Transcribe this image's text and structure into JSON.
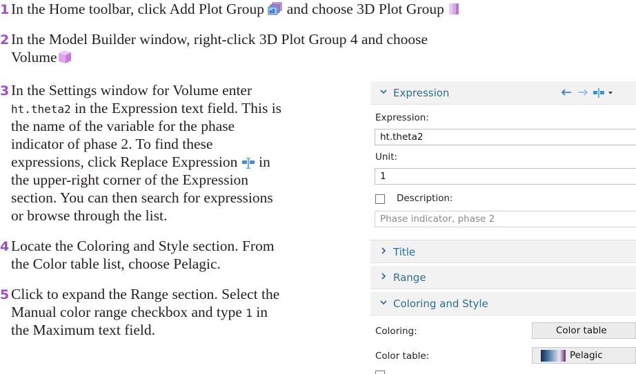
{
  "steps": [
    {
      "num": "1",
      "lines": [
        {
          "pre": "In the Home toolbar, click Add Plot Group",
          "mid": "and choose 3D Plot Group",
          "icon1": "plot-group-icon",
          "icon2": "3d-plot-group-icon"
        }
      ]
    },
    {
      "num": "2",
      "lines": [
        {
          "text": "In the Model Builder window, right-click 3D Plot Group 4 and choose"
        },
        {
          "text": "Volume",
          "icon": "volume-icon"
        }
      ]
    },
    {
      "num": "3",
      "lines": [
        {
          "text": "In the Settings window for Volume enter"
        },
        {
          "code": "ht.theta2",
          "text": " in the Expression text field. This is"
        },
        {
          "text": "the name of the variable for the phase"
        },
        {
          "text": "indicator of phase 2. To find these"
        },
        {
          "pre": "expressions, click Replace Expression",
          "post": "in",
          "icon": "replace-expression-icon"
        },
        {
          "text": "the upper-right corner of the Expression"
        },
        {
          "text": "section. You can then search for expressions"
        },
        {
          "text": "or browse through the list."
        }
      ]
    },
    {
      "num": "4",
      "lines": [
        {
          "text": "Locate the Coloring and Style section. From"
        },
        {
          "text": "the Color table list, choose Pelagic."
        }
      ]
    },
    {
      "num": "5",
      "lines": [
        {
          "text": "Click to expand the Range section. Select the"
        },
        {
          "pre": "Manual color range checkbox and type ",
          "code": "1",
          "post": " in"
        },
        {
          "text": "the Maximum text field."
        }
      ]
    }
  ],
  "panel": {
    "expression_section": {
      "title": "Expression",
      "expression_label": "Expression:",
      "expression_value": "ht.theta2",
      "unit_label": "Unit:",
      "unit_value": "1",
      "description_label": "Description:",
      "description_value": "Phase indicator, phase 2"
    },
    "title_section": {
      "title": "Title"
    },
    "range_section": {
      "title": "Range"
    },
    "coloring_section": {
      "title": "Coloring and Style",
      "coloring_label": "Coloring:",
      "coloring_value": "Color table",
      "color_table_label": "Color table:",
      "color_table_value": "Pelagic"
    }
  },
  "colors": {
    "step_number": "#9a4fc7",
    "section_title": "#2e6f8e",
    "icon_purple": "#b06ad8"
  }
}
